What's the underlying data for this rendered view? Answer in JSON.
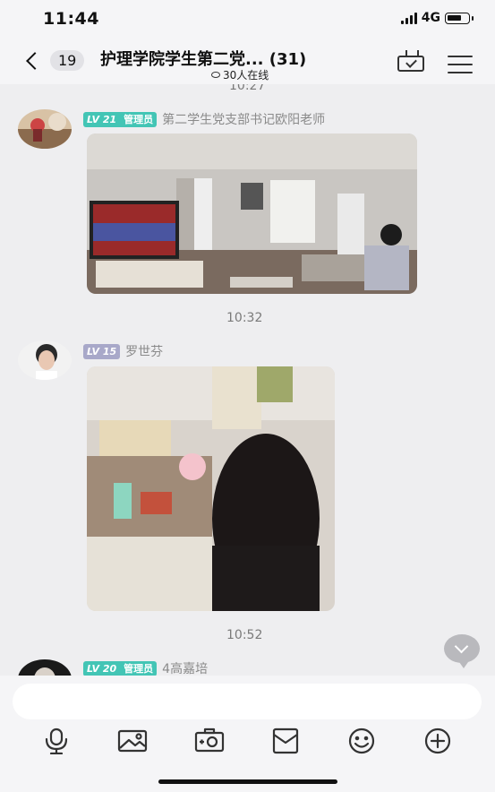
{
  "status_bar": {
    "time": "11:44",
    "network": "4G"
  },
  "nav": {
    "unread_count": "19",
    "title": "护理学院学生第二党... (31)",
    "online": "30人在线"
  },
  "messages": [
    {
      "time_above": "10:27",
      "level": "LV 21",
      "role": "管理员",
      "sender": "第二学生党支部书记欧阳老师"
    },
    {
      "time_above": "10:32",
      "level": "LV 15",
      "role": "",
      "sender": "罗世芬"
    },
    {
      "time_above": "10:52",
      "level": "LV 20",
      "role": "管理员",
      "sender": "4高嘉培"
    }
  ],
  "input": {
    "placeholder": ""
  },
  "toolbar": [
    "voice-icon",
    "image-icon",
    "camera-icon",
    "red-packet-icon",
    "emoji-icon",
    "plus-icon"
  ]
}
